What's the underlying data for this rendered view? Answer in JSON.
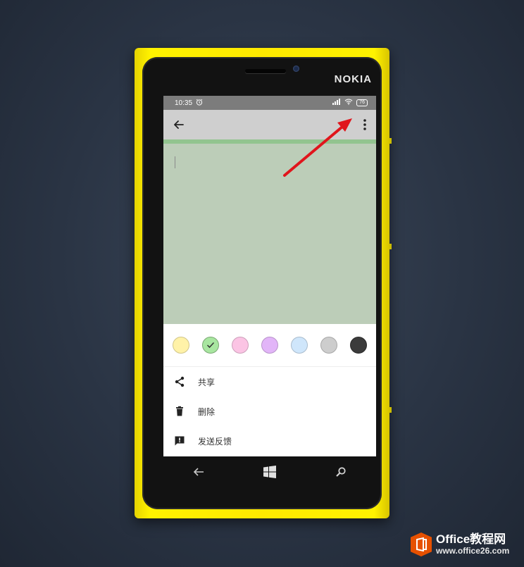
{
  "device": {
    "brand": "NOKIA"
  },
  "statusbar": {
    "time": "10:35",
    "battery": "76"
  },
  "toolbar": {
    "back_icon": "arrow-left-icon",
    "more_icon": "more-vert-icon"
  },
  "colors": {
    "selected_index": 1,
    "swatches": [
      "#fff2a8",
      "#a8e6a0",
      "#fbc4e4",
      "#e2b5f8",
      "#cfe6fb",
      "#cdcdcd",
      "#3b3b3b"
    ]
  },
  "menu": {
    "items": [
      {
        "label": "共享",
        "icon": "share-icon"
      },
      {
        "label": "删除",
        "icon": "trash-icon"
      },
      {
        "label": "发送反馈",
        "icon": "feedback-icon"
      }
    ]
  },
  "navbar": {
    "back_icon": "back-arrow-icon",
    "home_icon": "windows-logo-icon",
    "search_icon": "search-icon"
  },
  "annotation": {
    "arrow_color": "#e0151c"
  },
  "watermark": {
    "line1": "Office教程网",
    "line2": "www.office26.com"
  }
}
